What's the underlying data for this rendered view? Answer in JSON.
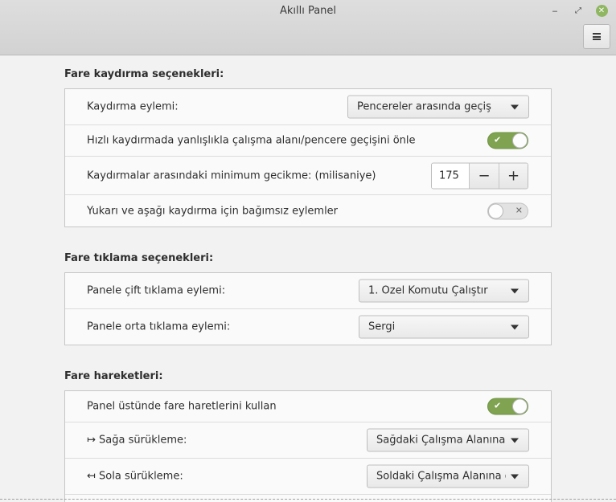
{
  "window": {
    "title": "Akıllı Panel",
    "minimize_glyph": "‒",
    "maximize_glyph": "⤢",
    "close_glyph": "✕"
  },
  "sections": {
    "scroll": {
      "title": "Fare kaydırma seçenekleri:",
      "action_label": "Kaydırma eylemi:",
      "action_value": "Pencereler arasında geçiş",
      "prevent_label": "Hızlı kaydırmada yanlışlıkla çalışma alanı/pencere geçişini önle",
      "prevent_on": true,
      "delay_label": "Kaydırmalar arasındaki minimum gecikme: (milisaniye)",
      "delay_value": "175",
      "minus": "−",
      "plus": "+",
      "independent_label": "Yukarı ve aşağı kaydırma için bağımsız eylemler",
      "independent_on": false
    },
    "click": {
      "title": "Fare tıklama seçenekleri:",
      "double_label": "Panele çift tıklama eylemi:",
      "double_value": "1. Özel Komutu Çalıştır",
      "middle_label": "Panele orta tıklama eylemi:",
      "middle_value": "Sergi"
    },
    "gestures": {
      "title": "Fare hareketleri:",
      "use_label": "Panel üstünde fare haretlerini kullan",
      "use_on": true,
      "right_label": "↦ Sağa sürükleme:",
      "right_value": "Sağdaki Çalışma Alanına git",
      "left_label": "↤ Sola sürükleme:",
      "left_value": "Soldaki Çalışma Alanına git"
    }
  },
  "toggle_marks": {
    "on": "✔",
    "off": "✕"
  },
  "colors": {
    "accent": "#7fa350",
    "close": "#8fb661",
    "titlebar": "#d8d8d8"
  }
}
